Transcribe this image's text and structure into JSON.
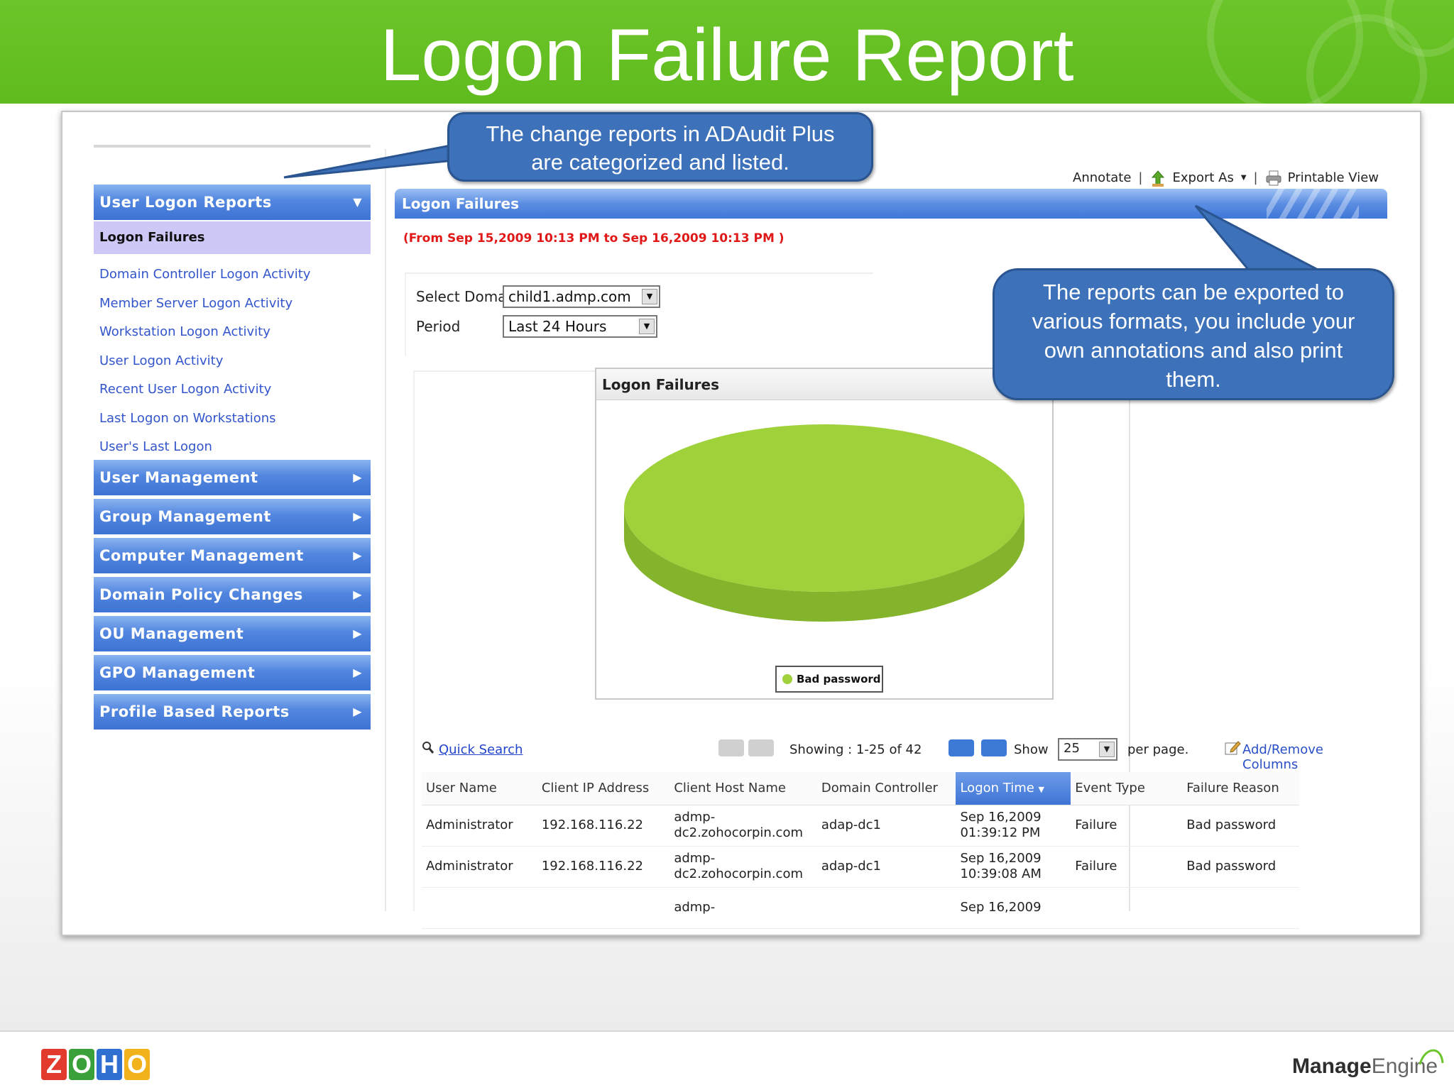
{
  "slide": {
    "title": "Logon Failure Report"
  },
  "callouts": {
    "categorized": [
      "The change reports in ADAudit Plus",
      "are categorized and listed."
    ],
    "export": [
      "The reports can be exported to",
      "various formats, you include your",
      "own annotations and also print",
      "them."
    ]
  },
  "sidebar": {
    "header": "User Logon Reports",
    "active_item": "Logon Failures",
    "items": [
      "Domain Controller Logon Activity",
      "Member Server Logon Activity",
      "Workstation Logon Activity",
      "User Logon Activity",
      "Recent User Logon Activity",
      "Last Logon on Workstations",
      "User's Last Logon"
    ],
    "sections": [
      "User Management",
      "Group Management",
      "Computer Management",
      "Domain Policy Changes",
      "OU Management",
      "GPO Management",
      "Profile Based Reports"
    ]
  },
  "toolbar": {
    "annotate": "Annotate",
    "export": "Export As",
    "printable": "Printable View",
    "separator": "|"
  },
  "report": {
    "title": "Logon Failures",
    "date_range": "(From Sep 15,2009 10:13 PM to Sep 16,2009 10:13 PM )",
    "domain_label": "Select Domain",
    "domain_value": "child1.admp.com",
    "period_label": "Period",
    "period_value": "Last 24 Hours"
  },
  "chart_data": {
    "type": "pie",
    "title": "Logon Failures",
    "categories": [
      "Bad password"
    ],
    "values": [
      100
    ],
    "colors": [
      "#9fd13b"
    ],
    "legend": "bottom"
  },
  "grid": {
    "quick_search": "Quick Search",
    "showing": "Showing : 1-25 of 42",
    "show_label": "Show",
    "per_page_value": "25",
    "per_page_label": "per page.",
    "add_remove": "Add/Remove Columns",
    "columns": [
      "User Name",
      "Client IP Address",
      "Client Host Name",
      "Domain Controller",
      "Logon Time",
      "Event Type",
      "Failure Reason"
    ],
    "rows": [
      [
        "Administrator",
        "192.168.116.22",
        "admp-\ndc2.zohocorpin.com",
        "adap-dc1",
        "Sep 16,2009\n01:39:12 PM",
        "Failure",
        "Bad password"
      ],
      [
        "Administrator",
        "192.168.116.22",
        "admp-\ndc2.zohocorpin.com",
        "adap-dc1",
        "Sep 16,2009\n10:39:08 AM",
        "Failure",
        "Bad password"
      ],
      [
        "",
        "",
        "admp-",
        "",
        "Sep 16,2009",
        "",
        ""
      ]
    ]
  },
  "footer": {
    "zoho_letters": [
      "Z",
      "O",
      "H",
      "O"
    ],
    "zoho_colors": [
      "#e23a2d",
      "#3aa03a",
      "#2f6fd0",
      "#f2b21c"
    ],
    "me_brand": "Manage",
    "me_suffix": "Engine"
  }
}
